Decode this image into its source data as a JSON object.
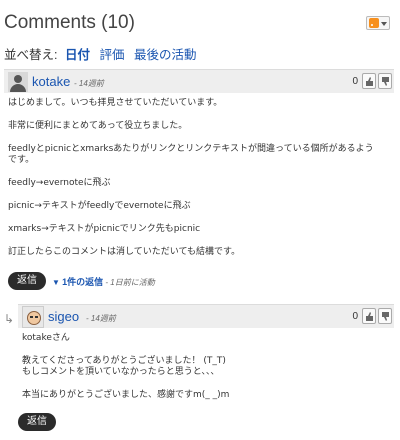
{
  "header": {
    "title": "Comments (10)",
    "rss_icon": "rss-feed-icon"
  },
  "sort": {
    "label": "並べ替え:",
    "options": [
      "日付",
      "評価",
      "最後の活動"
    ],
    "active": "日付"
  },
  "comments": [
    {
      "author": "kotake",
      "time": "- 14週前",
      "score": "0",
      "avatar_icon": "default-user-avatar-icon",
      "body": [
        "はじめまして。いつも拝見させていただいています。",
        "非常に便利にまとめてあって役立ちました。",
        "feedlyとpicnicとxmarksあたりがリンクとリンクテキストが間違っている個所があるようです。",
        "feedly→evernoteに飛ぶ",
        "picnic→テキストがfeedlyでevernoteに飛ぶ",
        "xmarks→テキストがpicnicでリンク先もpicnic",
        "訂正したらこのコメントは消していただいても結構です。"
      ],
      "reply_label": "返信",
      "replies_toggle": "1件の返信",
      "last_activity": "- 1日前に活動"
    },
    {
      "author": "sigeo",
      "time": "- 14週前",
      "score": "0",
      "avatar_icon": "user-avatar-icon",
      "body": [
        "kotakeさん",
        "教えてくださってありがとうございました！ (T_T)",
        "もしコメントを頂いていなかったらと思うと、、、",
        "本当にありがとうございました、感謝ですm(_ _)m"
      ],
      "reply_label": "返信"
    }
  ],
  "colors": {
    "link": "#1a55b0",
    "header_bar": "#eeeeee",
    "button": "#2b2b2b",
    "rss": "#f7901e"
  }
}
